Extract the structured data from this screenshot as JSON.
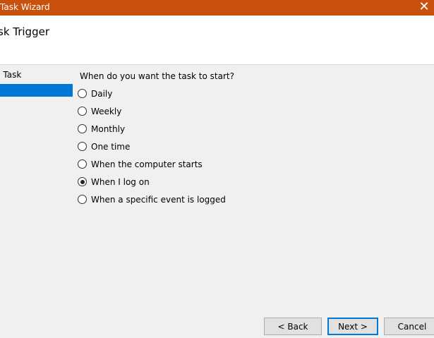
{
  "window": {
    "title": "Task Wizard",
    "close_glyph": "✕",
    "title_bar_color": "#c8510e",
    "accent_color": "#0078d7"
  },
  "header": {
    "heading": "sk Trigger"
  },
  "steps": [
    {
      "label": "c Task"
    },
    {
      "label": ""
    }
  ],
  "trigger": {
    "question": "When do you want the task to start?",
    "options": [
      {
        "label": "Daily",
        "selected": false
      },
      {
        "label": "Weekly",
        "selected": false
      },
      {
        "label": "Monthly",
        "selected": false
      },
      {
        "label": "One time",
        "selected": false
      },
      {
        "label": "When the computer starts",
        "selected": false
      },
      {
        "label": "When I log on",
        "selected": true
      },
      {
        "label": "When a specific event is logged",
        "selected": false
      }
    ]
  },
  "buttons": {
    "back": "< Back",
    "next": "Next >",
    "cancel": "Cancel"
  }
}
